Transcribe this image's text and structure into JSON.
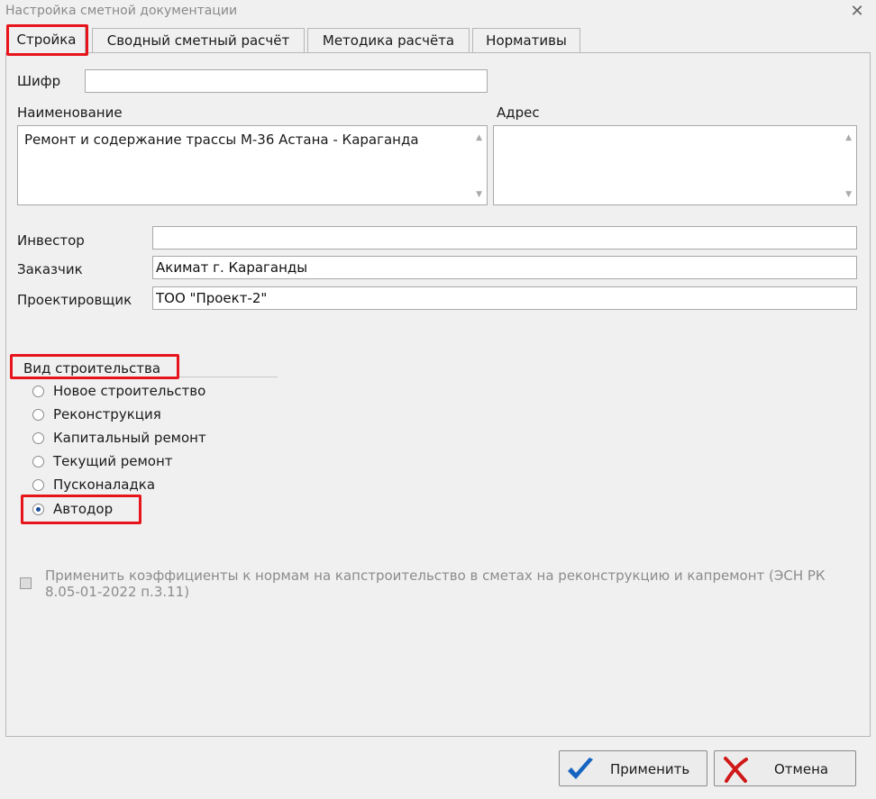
{
  "window": {
    "title": "Настройка сметной документации",
    "close_glyph": "✕"
  },
  "tabs": [
    {
      "label": "Стройка",
      "active": true
    },
    {
      "label": "Сводный сметный расчёт",
      "active": false
    },
    {
      "label": "Методика расчёта",
      "active": false
    },
    {
      "label": "Нормативы",
      "active": false
    }
  ],
  "form": {
    "cipher_label": "Шифр",
    "cipher_value": "",
    "name_label": "Наименование",
    "name_value": "Ремонт и содержание трассы М-36 Астана - Караганда",
    "address_label": "Адрес",
    "address_value": "",
    "investor_label": "Инвестор",
    "investor_value": "",
    "customer_label": "Заказчик",
    "customer_value": "Акимат г. Караганды",
    "designer_label": "Проектировщик",
    "designer_value": "ТОО \"Проект-2\""
  },
  "construction_type": {
    "title": "Вид строительства",
    "options": [
      {
        "label": "Новое строительство",
        "checked": false
      },
      {
        "label": "Реконструкция",
        "checked": false
      },
      {
        "label": "Капитальный ремонт",
        "checked": false
      },
      {
        "label": "Текущий ремонт",
        "checked": false
      },
      {
        "label": "Пусконаладка",
        "checked": false
      },
      {
        "label": "Автодор",
        "checked": true
      }
    ]
  },
  "coefficients_checkbox": {
    "label": "Применить коэффициенты к нормам на капстроительство в сметах на реконструкцию и капремонт (ЭСН РК 8.05-01-2022 п.3.11)",
    "checked": false,
    "enabled": false
  },
  "buttons": {
    "apply_label": "Применить",
    "cancel_label": "Отмена"
  },
  "icons": {
    "apply": "checkmark-icon",
    "cancel": "cross-icon",
    "scroll_up": "scroll-up-arrow-icon",
    "scroll_down": "scroll-down-arrow-icon"
  },
  "colors": {
    "highlight": "#e8141c",
    "check_blue": "#1565c0",
    "cross_red": "#d01818",
    "disabled_text": "#8c8c8c"
  }
}
